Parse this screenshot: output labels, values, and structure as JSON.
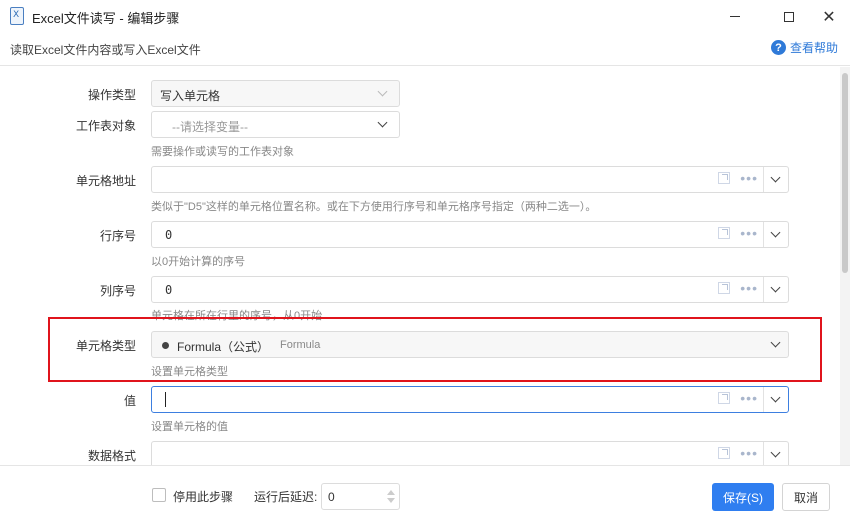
{
  "window": {
    "title": "Excel文件读写 - 编辑步骤",
    "icon": "excel-file-icon"
  },
  "header": {
    "description": "读取Excel文件内容或写入Excel文件",
    "help_label": "查看帮助",
    "help_icon": "?"
  },
  "form": {
    "op_type": {
      "label": "操作类型",
      "value": "写入单元格"
    },
    "sheet": {
      "label": "工作表对象",
      "placeholder": "--请选择变量--",
      "hint": "需要操作或读写的工作表对象"
    },
    "cell_addr": {
      "label": "单元格地址",
      "hint": "类似于\"D5\"这样的单元格位置名称。或在下方使用行序号和单元格序号指定（两种二选一）。"
    },
    "row_index": {
      "label": "行序号",
      "value": "0",
      "hint": "以0开始计算的序号"
    },
    "col_index": {
      "label": "列序号",
      "value": "0",
      "hint": "单元格在所在行里的序号，从0开始"
    },
    "cell_type": {
      "label": "单元格类型",
      "value": "Formula（公式）",
      "sub": "Formula",
      "hint": "设置单元格类型"
    },
    "value": {
      "label": "值",
      "hint": "设置单元格的值"
    },
    "format": {
      "label": "数据格式"
    }
  },
  "footer": {
    "disable_label": "停用此步骤",
    "delay_label": "运行后延迟:",
    "delay_value": "0",
    "save_label": "保存(S)",
    "cancel_label": "取消"
  },
  "colors": {
    "accent": "#2f7ef0",
    "highlight": "#e0141c"
  }
}
